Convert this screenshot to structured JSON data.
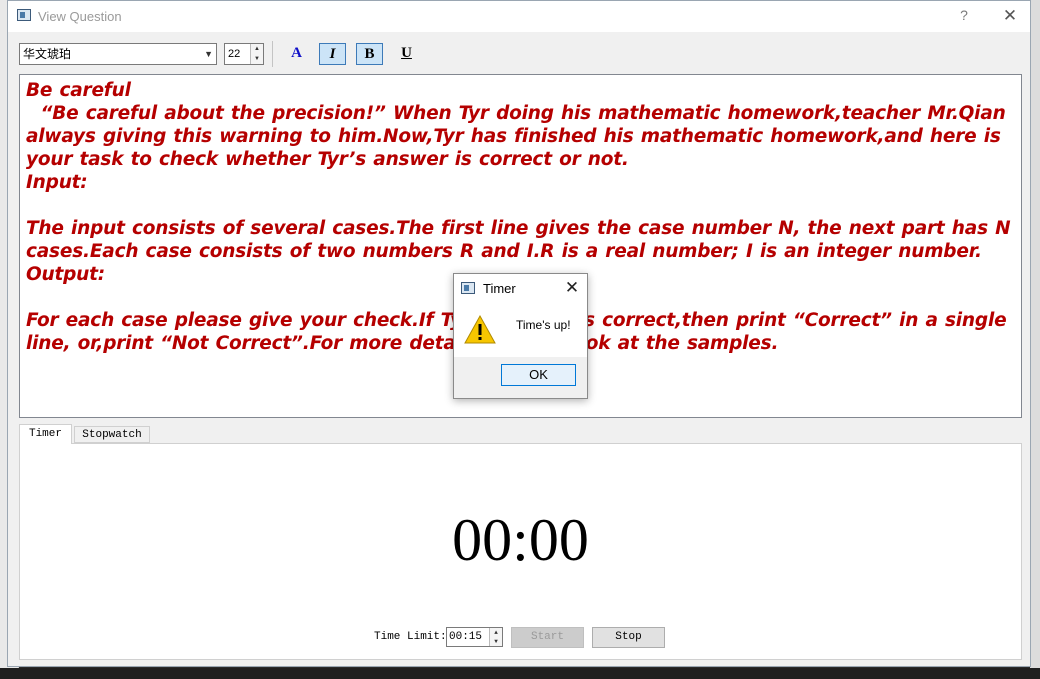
{
  "window": {
    "title": "View Question",
    "help": "?",
    "close": "✕"
  },
  "toolbar": {
    "font_name": "华文琥珀",
    "font_size": "22",
    "color_label": "A",
    "italic_label": "I",
    "bold_label": "B",
    "underline_label": "U"
  },
  "question": {
    "title": "Be careful",
    "paragraph1": "  “Be careful about the precision!” When Tyr doing his mathematic homework,teacher Mr.Qian always giving this warning to him.Now,Tyr has finished his mathematic homework,and here is your task to check whether Tyr’s answer is correct or not.",
    "input_heading": "Input:",
    "input_text": "The input consists of several cases.The first line gives the case number N, the next part has N cases.Each case consists of two numbers R and I.R is a real number; I is an integer number.",
    "output_heading": "Output:",
    "output_text": "For each case please give your check.If Tyr’s answer is correct,then print “Correct” in a single line, or,print “Not Correct”.For more details, please look at the samples."
  },
  "tabs": [
    {
      "label": "Timer"
    },
    {
      "label": "Stopwatch"
    }
  ],
  "timer": {
    "display": "00:00",
    "limit_label": "Time Limit:",
    "limit_value": "00:15",
    "start_label": "Start",
    "stop_label": "Stop"
  },
  "dialog": {
    "title": "Timer",
    "message": "Time's up!",
    "ok_label": "OK",
    "close": "✕"
  },
  "colors": {
    "text_accent": "#b50000",
    "selected_button": "#cce4f7"
  }
}
